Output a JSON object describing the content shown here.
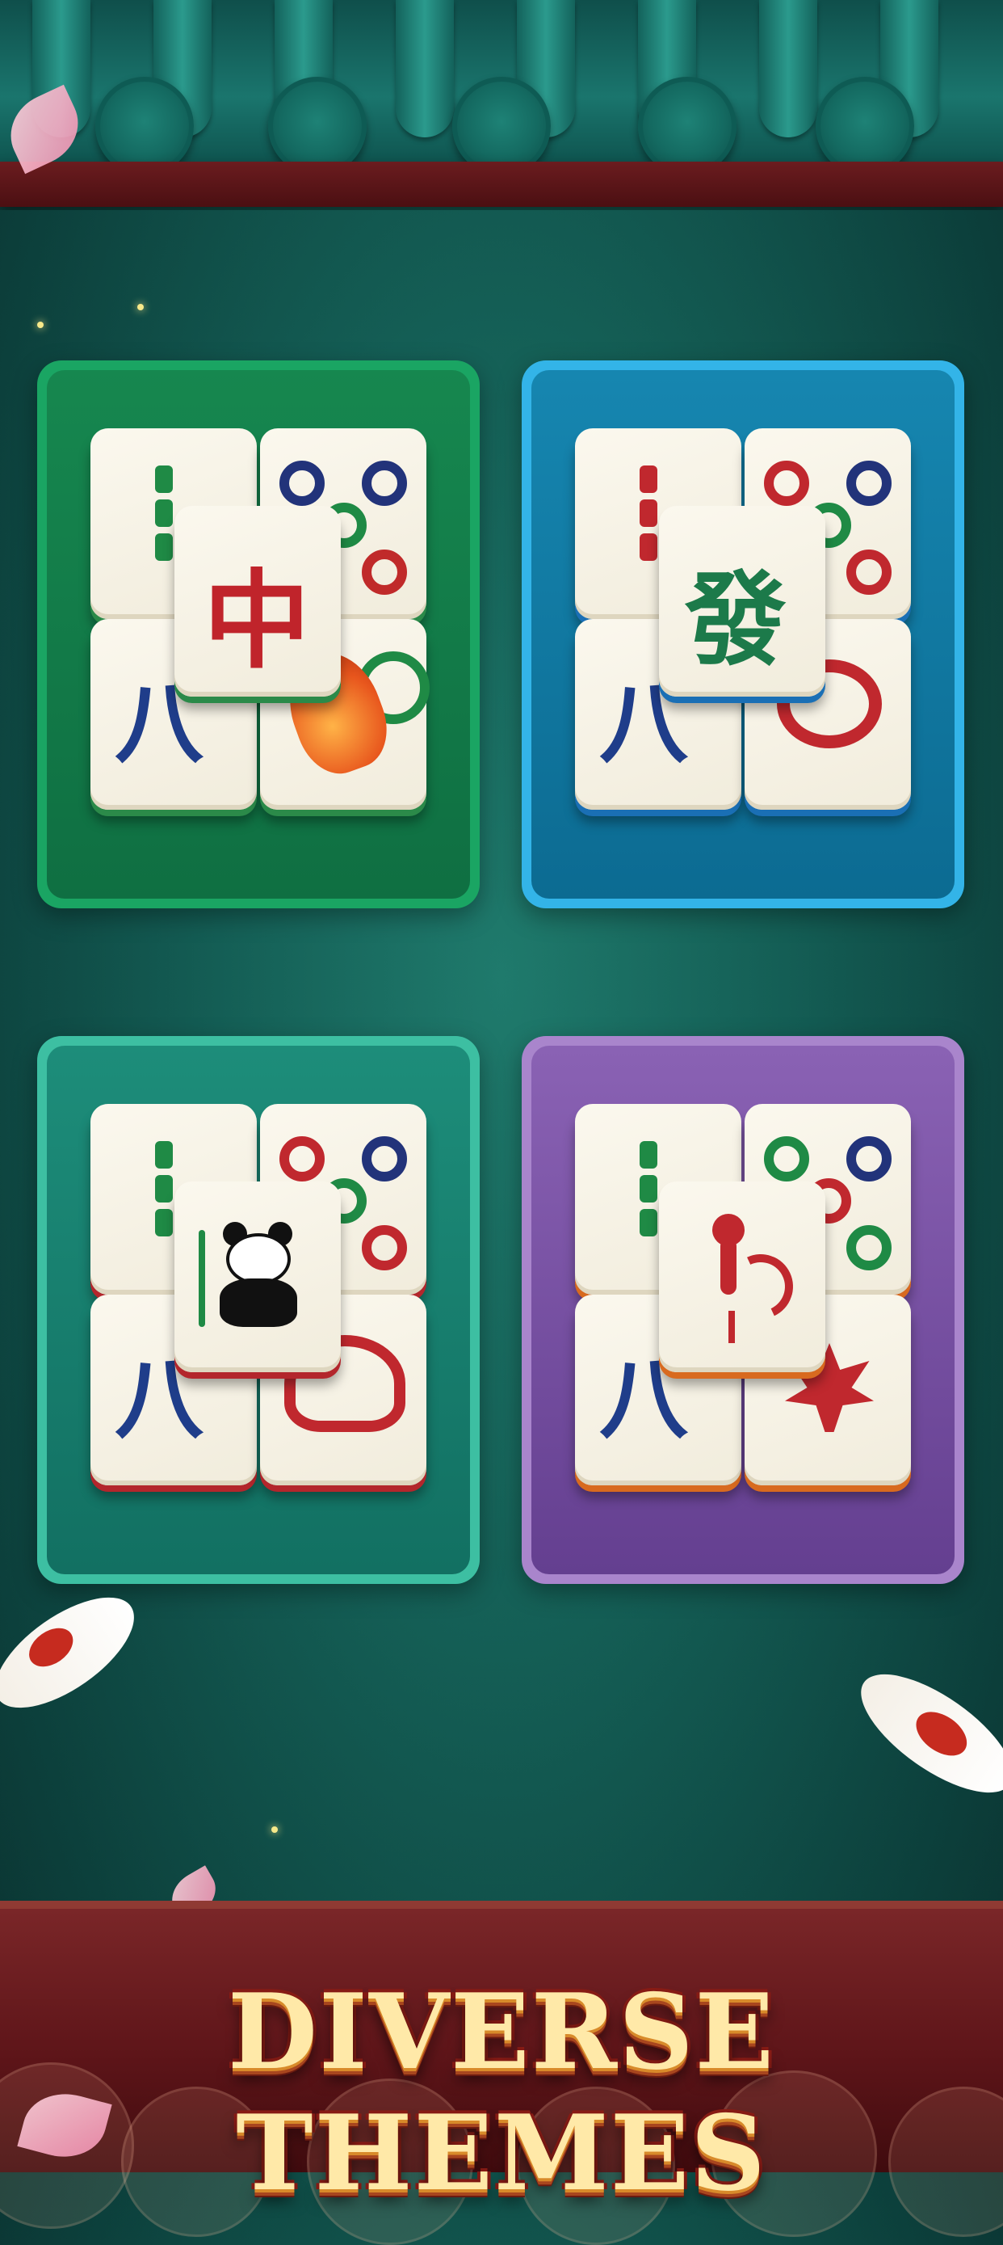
{
  "title": "DIVERSE THEMES",
  "themes": [
    {
      "name": "green",
      "accent": "#1aa563",
      "center_glyph": "中",
      "corner_glyph": "八",
      "motif": "koi-icon"
    },
    {
      "name": "blue",
      "accent": "#33b4e8",
      "center_glyph": "發",
      "corner_glyph": "八",
      "motif": "cloud-icon"
    },
    {
      "name": "teal",
      "accent": "#3dbfa2",
      "center_glyph": "",
      "corner_glyph": "八",
      "motif": "panda-icon"
    },
    {
      "name": "purple",
      "accent": "#a985cc",
      "center_glyph": "",
      "corner_glyph": "八",
      "motif": "rooster-icon"
    }
  ]
}
